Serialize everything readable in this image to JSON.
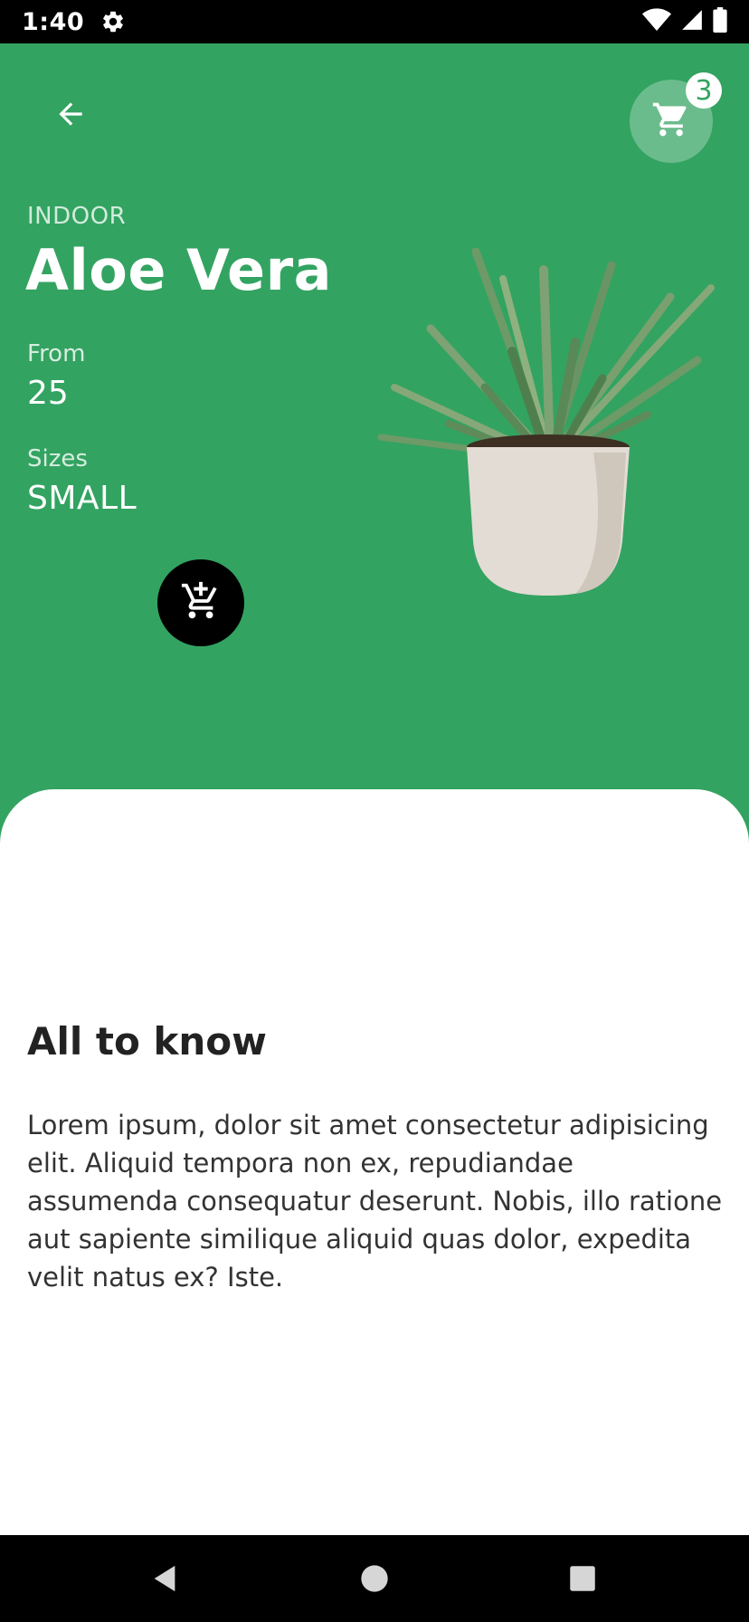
{
  "status_bar": {
    "time": "1:40"
  },
  "header": {
    "cart_count": "3"
  },
  "product": {
    "category": "INDOOR",
    "name": "Aloe Vera",
    "price_label": "From",
    "price": "25",
    "sizes_label": "Sizes",
    "size": "SMALL"
  },
  "details": {
    "title": "All to know",
    "body": "Lorem ipsum, dolor sit amet consectetur adipisicing elit. Aliquid tempora non ex, repudiandae assumenda consequatur deserunt. Nobis, illo ratione aut sapiente similique aliquid quas dolor, expedita velit natus ex? Iste."
  },
  "icons": {
    "back": "arrow-back-icon",
    "cart": "shopping-cart-icon",
    "add_to_cart": "add-shopping-cart-icon",
    "settings": "gear-icon",
    "wifi": "wifi-icon",
    "signal": "cell-signal-icon",
    "battery": "battery-icon"
  },
  "colors": {
    "primary": "#33a361",
    "sheet": "#ffffff",
    "fab": "#000000"
  }
}
